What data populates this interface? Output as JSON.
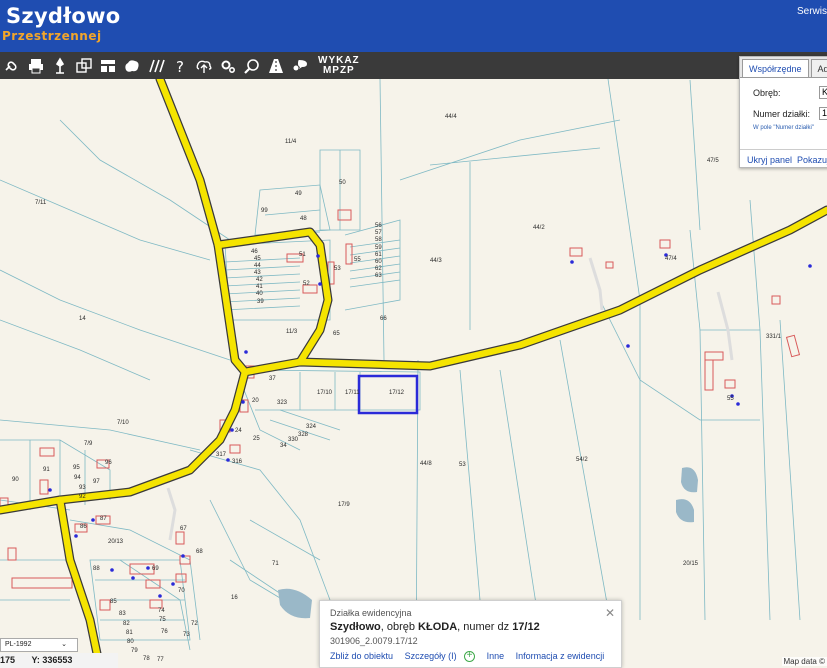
{
  "header": {
    "title": "Szydłowo",
    "subtitle": "Przestrzennej",
    "right_link": "Serwis"
  },
  "toolbar": {
    "tools": [
      "link-icon",
      "print-icon",
      "pin-icon",
      "layers-icon",
      "layout-icon",
      "cloud-shape-icon",
      "hatch-icon",
      "help-icon",
      "cloud-upload-icon",
      "gears-icon",
      "magnifier-icon",
      "road-icon",
      "comment-icon"
    ],
    "wykaz_line1": "WYKAZ",
    "wykaz_line2": "MPZP"
  },
  "search_panel": {
    "tab_coords": "Współrzędne",
    "tab_address": "Ad",
    "obreb_label": "Obręb:",
    "obreb_value": "K",
    "numer_label": "Numer działki:",
    "numer_value": "1",
    "hint": "W pole \"Numer działki\"",
    "hide_link": "Ukryj panel",
    "show_link": "Pokazuj"
  },
  "parcels": [
    "11/4",
    "44/4",
    "47/5",
    "7/11",
    "49",
    "50",
    "99",
    "48",
    "44/2",
    "56",
    "57",
    "58",
    "59",
    "61",
    "60",
    "62",
    "63",
    "46",
    "45",
    "44",
    "43",
    "42",
    "41",
    "40",
    "39",
    "51",
    "52",
    "53",
    "55",
    "44/3",
    "47/4",
    "14",
    "66",
    "11/3",
    "65",
    "331/1",
    "7/10",
    "37",
    "17/10",
    "17/11",
    "17/12",
    "20",
    "323",
    "324",
    "328",
    "330",
    "34",
    "25",
    "24",
    "317",
    "316",
    "7/9",
    "91",
    "95",
    "96",
    "94",
    "97",
    "90",
    "93",
    "92",
    "44/8",
    "53",
    "54/2",
    "55",
    "17/9",
    "86",
    "87",
    "67",
    "20/13",
    "68",
    "88",
    "69",
    "70",
    "85",
    "83",
    "82",
    "81",
    "80",
    "79",
    "78",
    "77",
    "76",
    "75",
    "74",
    "73",
    "72",
    "71",
    "16",
    "20/15",
    "54/1",
    "17/4"
  ],
  "popup": {
    "title": "Działka ewidencyjna",
    "place": "Szydłowo",
    "mid": ", obręb ",
    "obreb": "KŁODA",
    "num_prefix": ", numer dz ",
    "num": "17/12",
    "id": "301906_2.0079.17/12",
    "link_zoom": "Zbliż do obiektu",
    "link_details": "Szczegóły (I)",
    "link_other": "Inne",
    "link_info": "Informacja z ewidencji"
  },
  "status": {
    "crs": "PL-1992",
    "x_partial": "175",
    "y_label": "Y:",
    "y_value": "336553",
    "map_data": "Map data ©"
  },
  "colors": {
    "header_bg": "#1f4db1",
    "subtitle": "#f2a52a",
    "road": "#f5e400",
    "road_edge": "#3a3a3a",
    "selection": "#2a2ad8",
    "parcel_line": "#7fb9c4",
    "building": "#d85a5a"
  }
}
